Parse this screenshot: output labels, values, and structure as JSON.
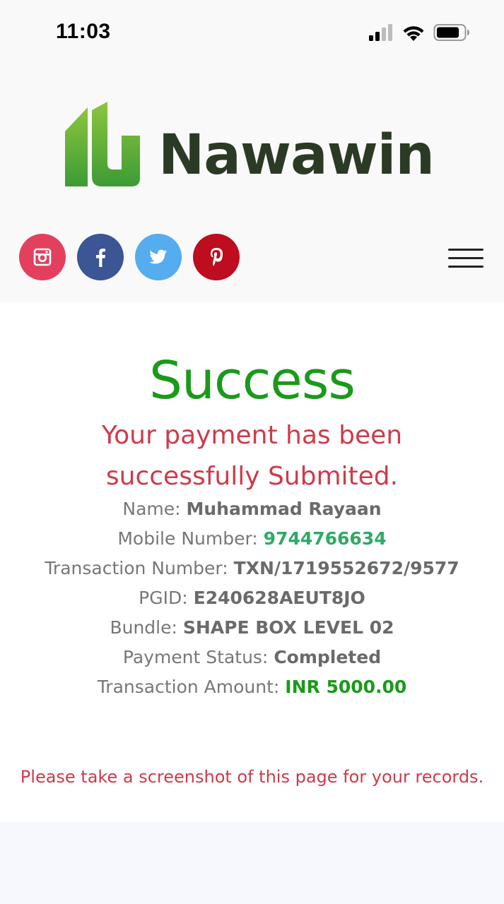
{
  "status_bar": {
    "time": "11:03"
  },
  "header": {
    "brand": "Nawawin",
    "social": [
      {
        "name": "instagram",
        "color": "#e2405d"
      },
      {
        "name": "facebook",
        "color": "#3b5595"
      },
      {
        "name": "twitter",
        "color": "#55acee"
      },
      {
        "name": "pinterest",
        "color": "#bd0d1f"
      }
    ]
  },
  "main": {
    "title": "Success",
    "message": "Your payment has been successfully Submited.",
    "details": [
      {
        "label": "Name: ",
        "value": "Muhammad Rayaan"
      },
      {
        "label": "Mobile Number: ",
        "value": "9744766634"
      },
      {
        "label": "Transaction Number: ",
        "value": "TXN/1719552672/9577"
      },
      {
        "label": "PGID: ",
        "value": "E240628AEUT8JO"
      },
      {
        "label": "Bundle: ",
        "value": "SHAPE BOX LEVEL 02"
      },
      {
        "label": "Payment Status: ",
        "value": "Completed"
      },
      {
        "label": "Transaction Amount: ",
        "value": "INR 5000.00"
      }
    ],
    "note": "Please take a screenshot of this page for your records."
  },
  "colors": {
    "success_green": "#1a9a1a",
    "message_red": "#cf3a4a",
    "mobile_green": "#2eaa67",
    "logo_dark": "#2b3a24"
  }
}
